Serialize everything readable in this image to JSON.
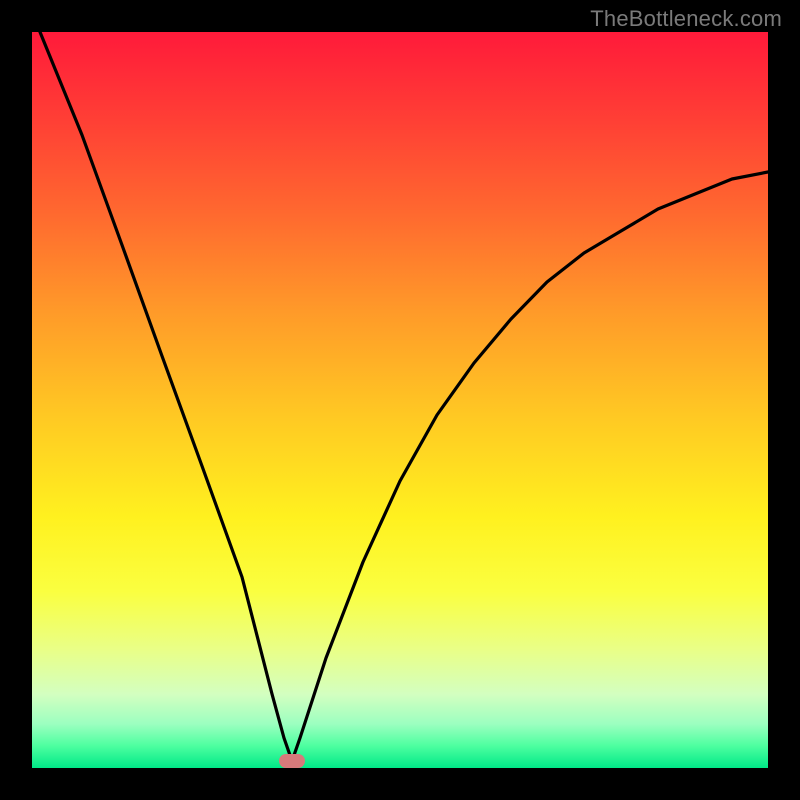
{
  "watermark": "TheBottleneck.com",
  "colors": {
    "frame": "#000000",
    "curve": "#000000",
    "marker": "#d77a7b",
    "watermark": "#7a7a7a"
  },
  "chart_data": {
    "type": "line",
    "title": "",
    "xlabel": "",
    "ylabel": "",
    "xlim": [
      0,
      100
    ],
    "ylim": [
      0,
      100
    ],
    "grid": false,
    "series": [
      {
        "name": "bottleneck-curve",
        "x": [
          0,
          5,
          10,
          15,
          20,
          25,
          30,
          32,
          34,
          36,
          40,
          45,
          50,
          55,
          60,
          65,
          70,
          75,
          80,
          85,
          90,
          95,
          100
        ],
        "values": [
          100,
          86,
          71,
          56,
          41,
          26,
          10,
          4,
          1,
          4,
          15,
          28,
          39,
          48,
          55,
          61,
          66,
          70,
          73,
          76,
          78,
          80,
          81
        ]
      }
    ],
    "marker": {
      "x": 33,
      "y": 0
    },
    "background_gradient": "red-yellow-green vertical"
  }
}
